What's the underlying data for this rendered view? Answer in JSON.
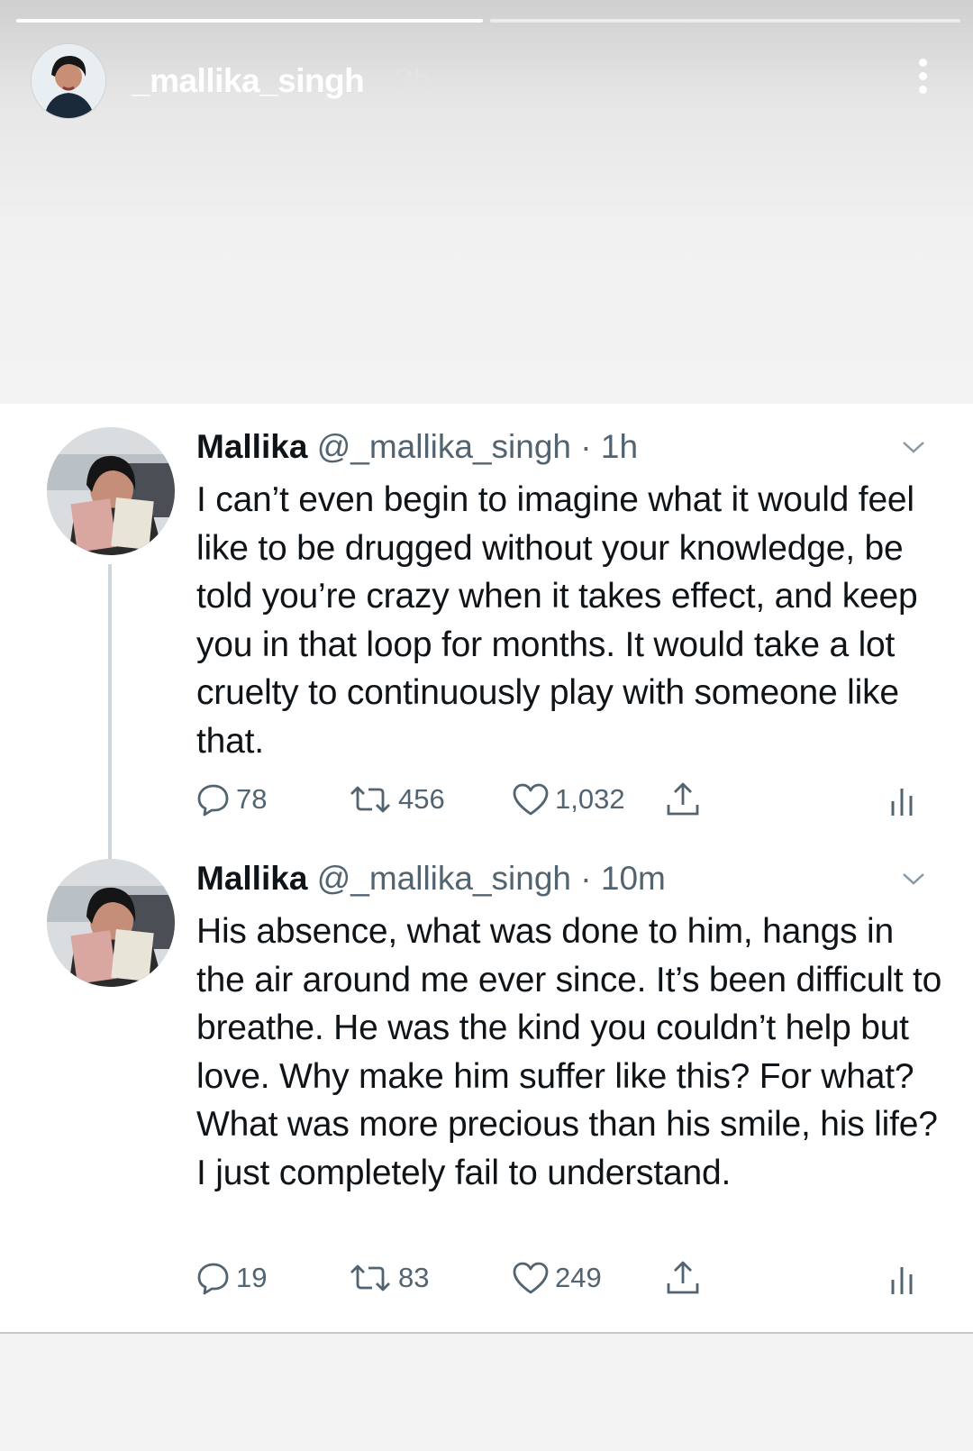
{
  "story": {
    "username": "_mallika_singh",
    "time": "3h",
    "progress": [
      1,
      0
    ]
  },
  "tweets": [
    {
      "name": "Mallika",
      "handle": "@_mallika_singh",
      "dot": "·",
      "time": "1h",
      "text": "I can’t even begin to imagine what it would feel like to be drugged without your knowledge, be told you’re crazy when it takes effect, and keep you in that loop for months. It would take a lot cruelty to continuously play with someone like that.",
      "replies": "78",
      "retweets": "456",
      "likes": "1,032"
    },
    {
      "name": "Mallika",
      "handle": "@_mallika_singh",
      "dot": "·",
      "time": "10m",
      "text": "His absence, what was done to him, hangs in the air around me ever since. It’s been difficult to breathe. He was the kind you couldn’t help but love. Why make him suffer like this? For what? What was more precious than his smile, his life? I just completely fail to understand.",
      "replies": "19",
      "retweets": "83",
      "likes": "249"
    }
  ],
  "icons": {
    "reply": "reply-icon",
    "retweet": "retweet-icon",
    "like": "heart-icon",
    "share": "share-icon",
    "analytics": "analytics-icon",
    "more": "more-vertical-icon",
    "caret": "chevron-down-icon"
  },
  "colors": {
    "text": "#0f1419",
    "secondary": "#536471",
    "thread_line": "#cdd6dd"
  }
}
